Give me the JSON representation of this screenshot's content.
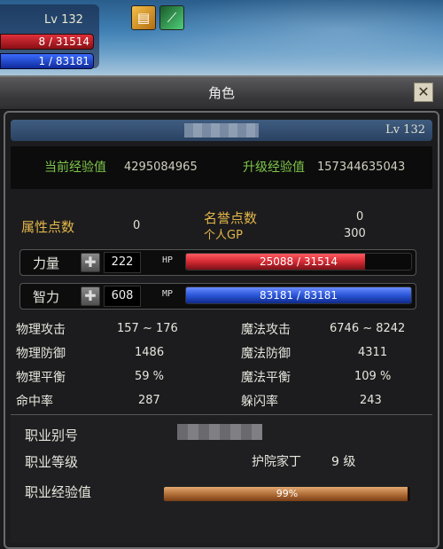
{
  "hud": {
    "level": "Lv 132",
    "hp_text": "8 / 31514",
    "mp_text": "1 / 83181"
  },
  "window": {
    "title": "角色",
    "close_glyph": "✕"
  },
  "character": {
    "level": "Lv 132",
    "current_exp_label": "当前经验值",
    "current_exp": "4295084965",
    "next_exp_label": "升级经验值",
    "next_exp": "157344635043"
  },
  "points": {
    "attr_points_label": "属性点数",
    "attr_points": "0",
    "honor_points_label": "名誉点数",
    "honor_points": "0",
    "gp_label": "个人GP",
    "gp": "300"
  },
  "stats": {
    "str_label": "力量",
    "str_value": "222",
    "hp_label": "HP",
    "hp_text": "25088 / 31514",
    "hp_fraction": 0.796,
    "int_label": "智力",
    "int_value": "608",
    "mp_label": "MP",
    "mp_text": "83181 / 83181",
    "mp_fraction": 1.0,
    "plus_glyph": "✚"
  },
  "combat": {
    "phys_atk_label": "物理攻击",
    "phys_atk": "157 ~ 176",
    "mag_atk_label": "魔法攻击",
    "mag_atk": "6746 ~ 8242",
    "phys_def_label": "物理防御",
    "phys_def": "1486",
    "mag_def_label": "魔法防御",
    "mag_def": "4311",
    "phys_bal_label": "物理平衡",
    "phys_bal": "59 %",
    "mag_bal_label": "魔法平衡",
    "mag_bal": "109 %",
    "hit_label": "命中率",
    "hit": "287",
    "dodge_label": "躲闪率",
    "dodge": "243"
  },
  "job": {
    "id_label": "职业别号",
    "level_label": "职业等级",
    "title": "护院家丁",
    "level": "9 级",
    "exp_label": "职业经验值",
    "exp_text": "99%",
    "exp_fraction": 0.99
  },
  "colors": {
    "hp_bar": "#d42a34",
    "mp_bar": "#2a56d8",
    "gold_text": "#e3b64a",
    "green_text": "#7ec64a"
  },
  "icons": {
    "skill1": "scroll-icon",
    "skill2": "sword-icon"
  }
}
